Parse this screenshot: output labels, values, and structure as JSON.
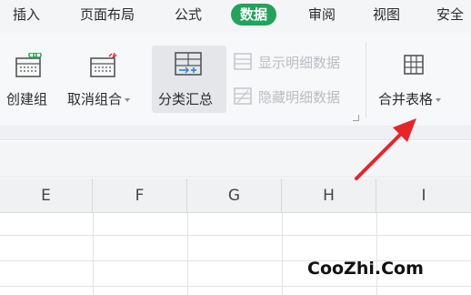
{
  "tabs": [
    {
      "label": "插入",
      "active": false
    },
    {
      "label": "页面布局",
      "active": false
    },
    {
      "label": "公式",
      "active": false
    },
    {
      "label": "数据",
      "active": true
    },
    {
      "label": "审阅",
      "active": false
    },
    {
      "label": "视图",
      "active": false
    },
    {
      "label": "安全",
      "active": false
    }
  ],
  "ribbon": {
    "create_group": {
      "label": "创建组",
      "icon": "create-group-icon"
    },
    "ungroup": {
      "label": "取消组合",
      "icon": "ungroup-icon"
    },
    "subtotal": {
      "label": "分类汇总",
      "icon": "subtotal-icon"
    },
    "show_detail": {
      "label": "显示明细数据",
      "icon": "show-detail-icon"
    },
    "hide_detail": {
      "label": "隐藏明细数据",
      "icon": "hide-detail-icon"
    },
    "merge_table": {
      "label": "合并表格",
      "icon": "merge-table-icon"
    }
  },
  "columns": [
    "E",
    "F",
    "G",
    "H",
    "I"
  ],
  "watermark": "CooZhi.Com",
  "colors": {
    "accent": "#23a35a",
    "arrow": "#e8242b"
  }
}
